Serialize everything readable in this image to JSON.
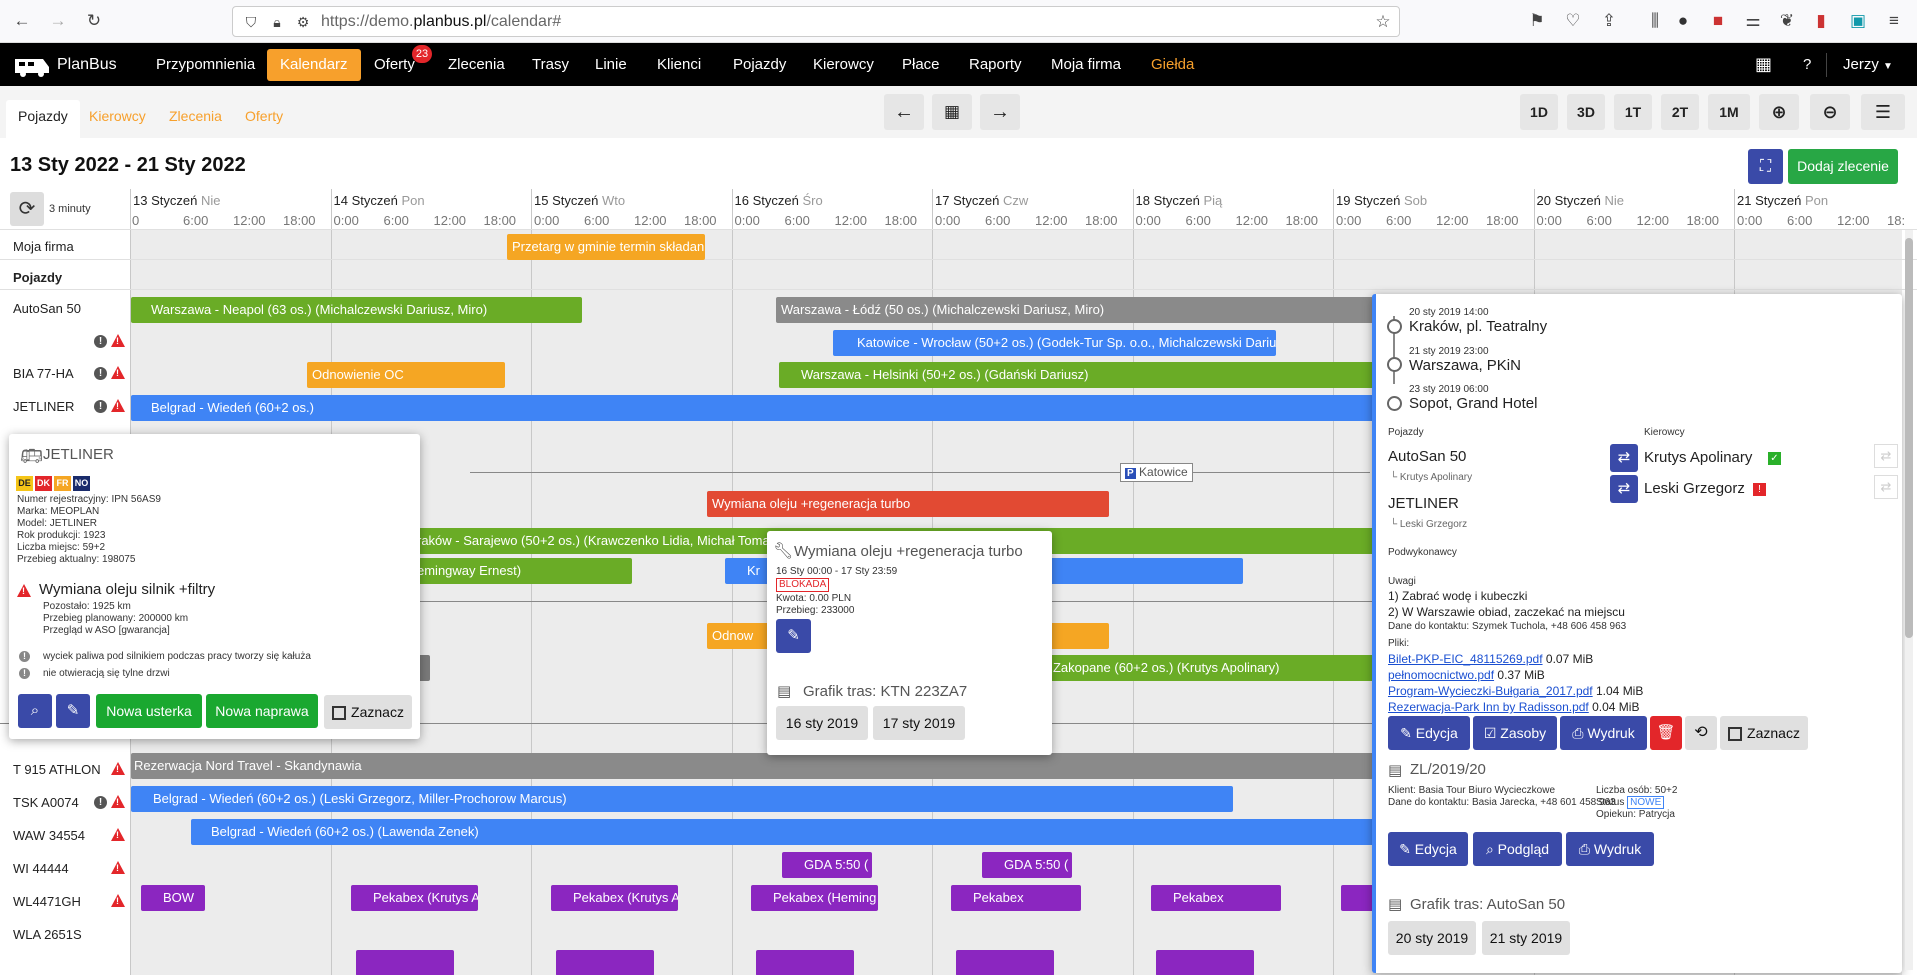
{
  "browser": {
    "url_prefix": "https://demo.",
    "url_host": "planbus.pl",
    "url_path": "/calendar#"
  },
  "brand": {
    "name": "PlanBus"
  },
  "nav": {
    "items": [
      "Przypomnienia",
      "Kalendarz",
      "Oferty",
      "Zlecenia",
      "Trasy",
      "Linie",
      "Klienci",
      "Pojazdy",
      "Kierowcy",
      "Płace",
      "Raporty",
      "Moja firma",
      "Giełda"
    ],
    "offers_badge": "23",
    "help": "?",
    "user": "Jerzy"
  },
  "subtabs": [
    "Pojazdy",
    "Kierowcy",
    "Zlecenia",
    "Oferty"
  ],
  "view_buttons": [
    "1D",
    "3D",
    "1T",
    "2T",
    "1M"
  ],
  "range_title": "13 Sty 2022 - 21 Sty 2022",
  "add_order": "Dodaj zlecenie",
  "refresh_label": "3 minuty",
  "days": [
    {
      "date": "13 Styczeń",
      "dow": "Nie"
    },
    {
      "date": "14 Styczeń",
      "dow": "Pon"
    },
    {
      "date": "15 Styczeń",
      "dow": "Wto"
    },
    {
      "date": "16 Styczeń",
      "dow": "Śro"
    },
    {
      "date": "17 Styczeń",
      "dow": "Czw"
    },
    {
      "date": "18 Styczeń",
      "dow": "Pią"
    },
    {
      "date": "19 Styczeń",
      "dow": "Sob"
    },
    {
      "date": "20 Styczeń",
      "dow": "Nie"
    },
    {
      "date": "21 Styczeń",
      "dow": "Pon"
    }
  ],
  "hours": [
    "0:00",
    "6:00",
    "12:00",
    "18:00"
  ],
  "rows": {
    "moja_firma": "Moja firma",
    "pojazdy": "Pojazdy",
    "autosan": "AutoSan 50",
    "bia": "BIA 77-HA",
    "jetliner": "JETLINER",
    "t915": "T 915 ATHLON",
    "tsk": "TSK A0074",
    "waw": "WAW 34554",
    "wi": "WI 44444",
    "wl": "WL4471GH",
    "wla": "WLA 2651S"
  },
  "bars": {
    "przetarg": "Przetarg w gminie termin składan",
    "neapol": "Warszawa - Neapol (63 os.) (Michalczewski Dariusz, Miro)",
    "lodz": "Warszawa - Łódź (50 os.) (Michalczewski Dariusz, Miro)",
    "katowice": "Katowice - Wrocław (50+2 os.) (Godek-Tur Sp. o.o., Michalczewski Darius",
    "odnowienie": "Odnowienie OC",
    "helsinki": "Warszawa - Helsinki (50+2 os.) (Gdański Dariusz)",
    "belgrad": "Belgrad - Wiedeń (60+2 os.)",
    "katowice_marker": "Katowice",
    "wymiana": "Wymiana oleju +regeneracja turbo",
    "sarajewo": "raków - Sarajewo (50+2 os.) (Krawczenko Lidia, Michał Toma",
    "hemingway": "emingway Ernest)",
    "kr": "Kr",
    "odnow2": "Odnow",
    "zakopane": "- Zakopane (60+2 os.) (Krutys Apolinary)",
    "nord": "Rezerwacja Nord Travel - Skandynawia",
    "belgrad2": "Belgrad - Wiedeń (60+2 os.) (Leski Grzegorz, Miller-Prochorow Marcus)",
    "belgrad3": "Belgrad - Wiedeń (60+2 os.) (Lawenda Zenek)",
    "gda1": "GDA 5:50 (",
    "gda2": "GDA 5:50 (",
    "bow": "BOW",
    "pek1": "Pekabex (Krutys A",
    "pek2": "Pekabex (Krutys A",
    "pek3": "Pekabex (Heming",
    "pek4": "Pekabex",
    "pek5": "Pekabex"
  },
  "vehicle_popup": {
    "name": "JETLINER",
    "flags": [
      "DE",
      "DK",
      "FR",
      "NO"
    ],
    "details": [
      "Numer rejestracyjny: IPN 56AS9",
      "Marka: MEOPLAN",
      "Model: JETLINER",
      "Rok produkcji: 1923",
      "Liczba miejsc: 59+2",
      "Przebieg aktualny: 198075"
    ],
    "service_title": "Wymiana oleju silnik +filtry",
    "service_details": [
      "Pozostało: 1925 km",
      "Przebieg planowany: 200000 km",
      "Przegląd w ASO [gwarancja]"
    ],
    "issues": [
      "wyciek paliwa pod silnikiem podczas pracy tworzy się kałuża",
      "nie otwieracją się tylne drzwi"
    ],
    "btn_new_fault": "Nowa usterka",
    "btn_new_repair": "Nowa naprawa",
    "btn_select": "Zaznacz"
  },
  "service_popup": {
    "title": "Wymiana oleju +regeneracja turbo",
    "date": "16 Sty 00:00 - 17 Sty 23:59",
    "badge": "BLOKADA",
    "amount": "Kwota: 0.00 PLN",
    "mileage": "Przebieg: 233000",
    "schedule_title": "Grafik tras: KTN 223ZA7",
    "dates": [
      "16 sty 2019",
      "17 sty 2019"
    ]
  },
  "order_panel": {
    "stops": [
      {
        "time": "20 sty 2019 14:00",
        "place": "Kraków, pl. Teatralny"
      },
      {
        "time": "21 sty 2019 23:00",
        "place": "Warszawa, PKiN"
      },
      {
        "time": "23 sty 2019 06:00",
        "place": "Sopot, Grand Hotel"
      }
    ],
    "vehicles_label": "Pojazdy",
    "drivers_label": "Kierowcy",
    "vehicles": [
      {
        "name": "AutoSan 50",
        "driver": "Krutys Apolinary"
      },
      {
        "name": "JETLINER",
        "driver": "Leski Grzegorz"
      }
    ],
    "drivers": [
      "Krutys Apolinary",
      "Leski Grzegorz"
    ],
    "subcontractors": "Podwykonawcy",
    "notes_label": "Uwagi",
    "notes": [
      "1) Zabrać wodę i kubeczki",
      "2) W Warszawie obiad, zaczekać na miejscu"
    ],
    "contact": "Dane do kontaktu: Szymek Tuchola, +48 606 458 963",
    "files_label": "Pliki:",
    "files": [
      {
        "name": "Bilet-PKP-EIC_48115269.pdf",
        "size": "0.07 MiB"
      },
      {
        "name": "pełnomocnictwo.pdf",
        "size": "0.37 MiB"
      },
      {
        "name": "Program-Wycieczki-Bułgaria_2017.pdf",
        "size": "1.04 MiB"
      },
      {
        "name": "Rezerwacja-Park Inn by Radisson.pdf",
        "size": "0.04 MiB"
      }
    ],
    "btn_edit": "Edycja",
    "btn_resources": "Zasoby",
    "btn_print": "Wydruk",
    "btn_select": "Zaznacz",
    "order_id": "ZL/2019/20",
    "client": "Klient: Basia Tour Biuro Wycieczkowe",
    "client_contact": "Dane do kontaktu: Basia Jarecka, +48 601 458 963",
    "people": "Liczba osób: 50+2",
    "status_label": "Status",
    "status": "NOWE",
    "guardian": "Opiekun: Patrycja",
    "btn_edit2": "Edycja",
    "btn_preview": "Podgląd",
    "btn_print2": "Wydruk",
    "schedule_title": "Grafik tras: AutoSan 50",
    "dates": [
      "20 sty 2019",
      "21 sty 2019"
    ]
  }
}
